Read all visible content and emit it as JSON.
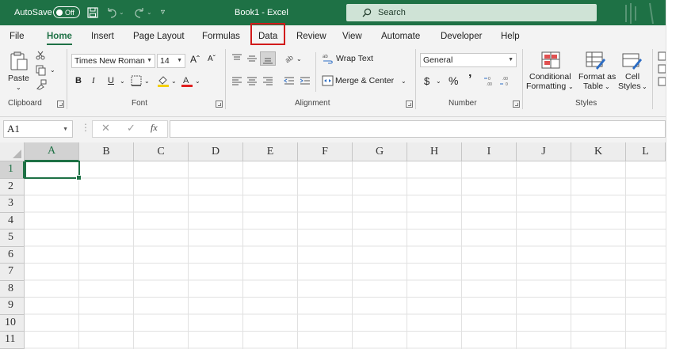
{
  "titlebar": {
    "autosave_label": "AutoSave",
    "autosave_state": "Off",
    "doc_title": "Book1  -  Excel",
    "search_placeholder": "Search"
  },
  "tabs": [
    {
      "label": "File",
      "active": false
    },
    {
      "label": "Home",
      "active": true
    },
    {
      "label": "Insert",
      "active": false
    },
    {
      "label": "Page Layout",
      "active": false
    },
    {
      "label": "Formulas",
      "active": false
    },
    {
      "label": "Data",
      "active": false,
      "highlighted": true
    },
    {
      "label": "Review",
      "active": false
    },
    {
      "label": "View",
      "active": false
    },
    {
      "label": "Automate",
      "active": false
    },
    {
      "label": "Developer",
      "active": false
    },
    {
      "label": "Help",
      "active": false
    }
  ],
  "ribbon": {
    "clipboard": {
      "paste_label": "Paste",
      "group_label": "Clipboard"
    },
    "font": {
      "font_name": "Times New Roman",
      "font_size": "14",
      "bold": "B",
      "italic": "I",
      "underline": "U",
      "grow": "Aˆ",
      "shrink": "Aˇ",
      "group_label": "Font"
    },
    "alignment": {
      "wrap_text": "Wrap Text",
      "merge_center": "Merge & Center",
      "group_label": "Alignment"
    },
    "number": {
      "format": "General",
      "currency": "$",
      "percent": "%",
      "comma": "’",
      "group_label": "Number"
    },
    "styles": {
      "conditional_formatting_1": "Conditional",
      "conditional_formatting_2": "Formatting",
      "format_as_table_1": "Format as",
      "format_as_table_2": "Table",
      "cell_styles_1": "Cell",
      "cell_styles_2": "Styles",
      "group_label": "Styles"
    }
  },
  "formula_bar": {
    "name_box": "A1",
    "fx": "fx",
    "formula": ""
  },
  "grid": {
    "columns": [
      "A",
      "B",
      "C",
      "D",
      "E",
      "F",
      "G",
      "H",
      "I",
      "J",
      "K",
      "L"
    ],
    "rows": [
      "1",
      "2",
      "3",
      "4",
      "5",
      "6",
      "7",
      "8",
      "9",
      "10",
      "11"
    ],
    "active_cell": "A1"
  },
  "colors": {
    "brand": "#1e7145",
    "highlight": "#d11a1a"
  }
}
